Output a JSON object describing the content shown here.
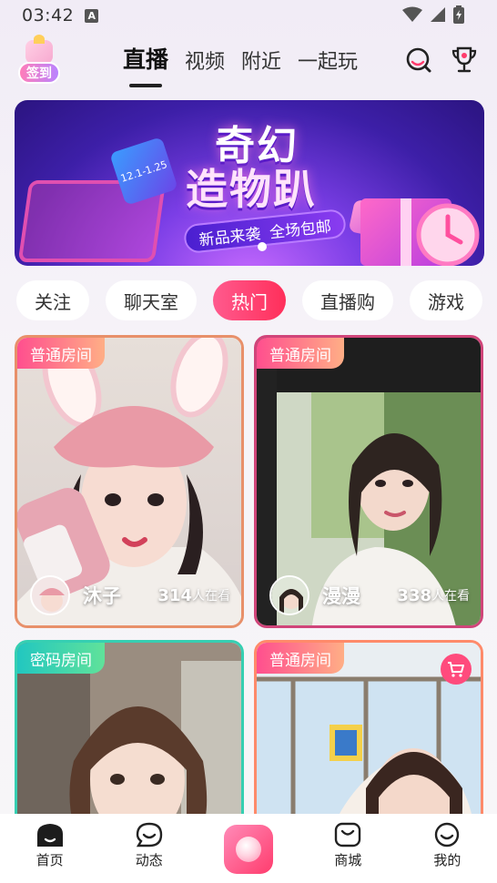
{
  "status_bar": {
    "time": "03:42",
    "a_icon": "A"
  },
  "header": {
    "signin_label": "签到",
    "tabs": [
      {
        "label": "直播",
        "active": true
      },
      {
        "label": "视频",
        "active": false
      },
      {
        "label": "附近",
        "active": false
      },
      {
        "label": "一起玩",
        "active": false
      }
    ]
  },
  "banner": {
    "title_line1": "奇幻",
    "title_line2": "造物趴",
    "subtitle_left": "新品来袭",
    "subtitle_right": "全场包邮",
    "date": "12.1-1.25"
  },
  "chips": [
    {
      "label": "关注",
      "active": false
    },
    {
      "label": "聊天室",
      "active": false
    },
    {
      "label": "热门",
      "active": true
    },
    {
      "label": "直播购",
      "active": false
    },
    {
      "label": "游戏",
      "active": false
    }
  ],
  "cards": [
    {
      "tag": "普通房间",
      "tag_type": "normal",
      "host": "沐子",
      "viewers": "314",
      "viewers_suffix": "人在看",
      "border_color": "#e8906a"
    },
    {
      "tag": "普通房间",
      "tag_type": "normal",
      "host": "漫漫",
      "viewers": "338",
      "viewers_suffix": "人在看",
      "border_color": "#d0457a"
    },
    {
      "tag": "密码房间",
      "tag_type": "secret",
      "border_color": "#36cfb2"
    },
    {
      "tag": "普通房间",
      "tag_type": "normal",
      "border_color": "#ff8a6a",
      "has_cart": true
    }
  ],
  "bottom_nav": [
    {
      "label": "首页",
      "icon": "home-icon",
      "active": true
    },
    {
      "label": "动态",
      "icon": "chat-smile-icon",
      "active": false
    },
    {
      "label": "",
      "icon": "live-start-icon",
      "active": false
    },
    {
      "label": "商城",
      "icon": "shop-bag-icon",
      "active": false
    },
    {
      "label": "我的",
      "icon": "profile-smile-icon",
      "active": false
    }
  ],
  "colors": {
    "accent": "#ff2f5a",
    "secret_tag": "#22c7c0"
  }
}
